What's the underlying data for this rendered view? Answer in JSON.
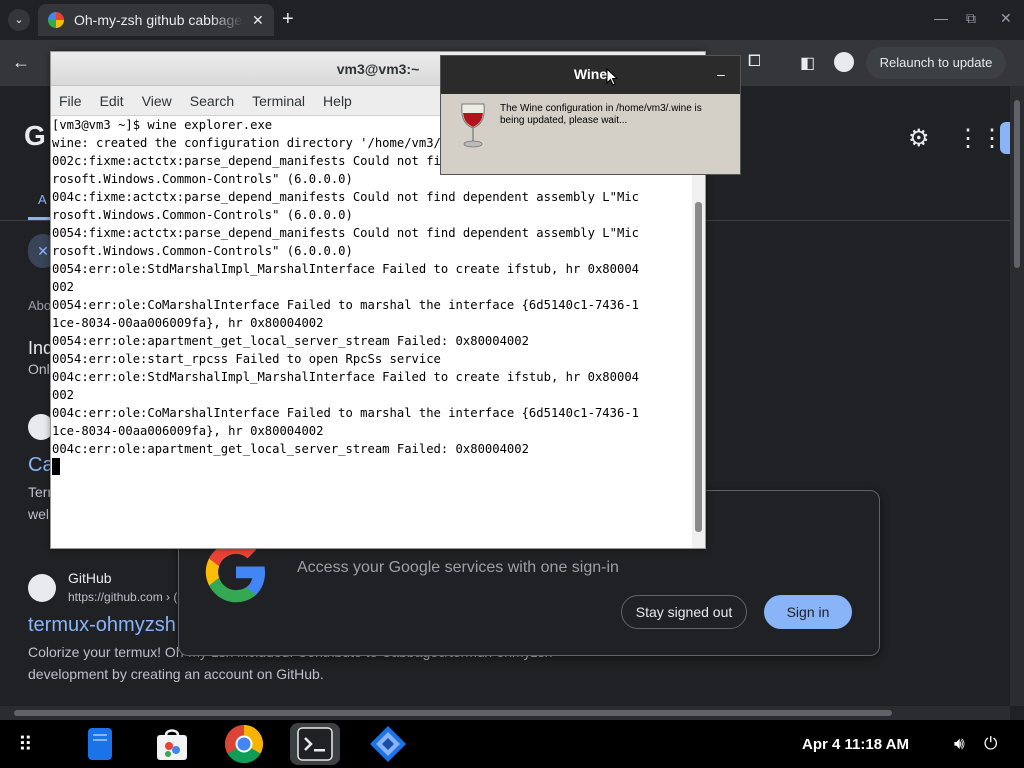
{
  "browser": {
    "tab_title": "Oh-my-zsh github cabbage",
    "tab_close": "✕",
    "new_tab": "+",
    "relaunch": "Relaunch to update",
    "colors": {
      "accent": "#8ab4f8",
      "background": "#202124"
    }
  },
  "page": {
    "logo_fragment": "G",
    "tab_fragment": "A",
    "chip_icon": "✕",
    "about_fragment": "Abo",
    "heading_fragment": "Ind",
    "sub_fragment": "Onl",
    "link_fragment": "Ca",
    "text_fragment_1": "Terr",
    "text_fragment_2": "wel",
    "result": {
      "site_name": "GitHub",
      "url": "https://github.com › (",
      "title": "termux-ohmyzsh",
      "snippet_line1": "Colorize your termux! Oh-my-zsh included. Contribute to Cabbagec/termux-ohmyzsh",
      "snippet_line2": "development by creating an account on GitHub."
    }
  },
  "signin_card": {
    "message": "Access your Google services with one sign-in",
    "stay_signed_out": "Stay signed out",
    "sign_in": "Sign in"
  },
  "terminal": {
    "title": "vm3@vm3:~",
    "menu": [
      "File",
      "Edit",
      "View",
      "Search",
      "Terminal",
      "Help"
    ],
    "lines": [
      "[vm3@vm3 ~]$ wine explorer.exe",
      "wine: created the configuration directory '/home/vm3/.wine'",
      "002c:fixme:actctx:parse_depend_manifests Could not find dependent assembly L\"Mic",
      "rosoft.Windows.Common-Controls\" (6.0.0.0)",
      "004c:fixme:actctx:parse_depend_manifests Could not find dependent assembly L\"Mic",
      "rosoft.Windows.Common-Controls\" (6.0.0.0)",
      "0054:fixme:actctx:parse_depend_manifests Could not find dependent assembly L\"Mic",
      "rosoft.Windows.Common-Controls\" (6.0.0.0)",
      "0054:err:ole:StdMarshalImpl_MarshalInterface Failed to create ifstub, hr 0x80004",
      "002",
      "0054:err:ole:CoMarshalInterface Failed to marshal the interface {6d5140c1-7436-1",
      "1ce-8034-00aa006009fa}, hr 0x80004002",
      "0054:err:ole:apartment_get_local_server_stream Failed: 0x80004002",
      "0054:err:ole:start_rpcss Failed to open RpcSs service",
      "004c:err:ole:StdMarshalImpl_MarshalInterface Failed to create ifstub, hr 0x80004",
      "002",
      "004c:err:ole:CoMarshalInterface Failed to marshal the interface {6d5140c1-7436-1",
      "1ce-8034-00aa006009fa}, hr 0x80004002",
      "004c:err:ole:apartment_get_local_server_stream Failed: 0x80004002"
    ]
  },
  "wine_dialog": {
    "title": "Wine",
    "minimize": "–",
    "message": "The Wine configuration in /home/vm3/.wine is being updated, please wait..."
  },
  "shelf": {
    "clock": "Apr 4  11:18 AM",
    "apps": [
      "files-icon",
      "store-icon",
      "chrome-icon",
      "terminal-icon",
      "app-icon"
    ]
  }
}
